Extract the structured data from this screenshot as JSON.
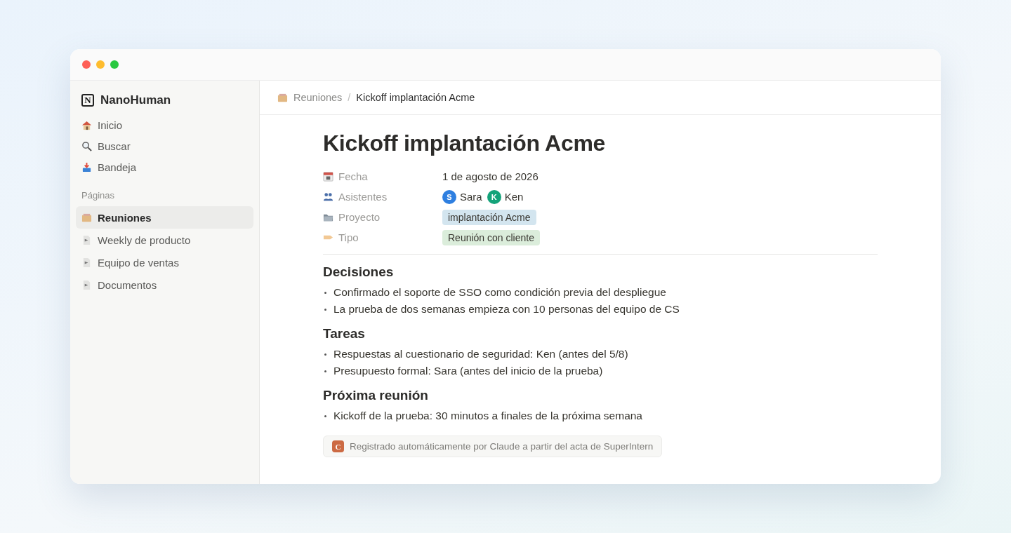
{
  "sidebar": {
    "workspace": {
      "logo_letter": "N",
      "name": "NanoHuman"
    },
    "nav": [
      {
        "label": "Inicio",
        "selected": false
      },
      {
        "label": "Buscar",
        "selected": false
      },
      {
        "label": "Bandeja",
        "selected": false
      }
    ],
    "section_title": "Páginas",
    "pages": [
      {
        "label": "Reuniones",
        "selected": true
      },
      {
        "label": "Weekly de producto",
        "selected": false
      },
      {
        "label": "Equipo de ventas",
        "selected": false
      },
      {
        "label": "Documentos",
        "selected": false
      }
    ]
  },
  "breadcrumb": {
    "parent": "Reuniones",
    "separator": "/",
    "current": "Kickoff implantación Acme"
  },
  "page": {
    "title": "Kickoff implantación Acme",
    "properties": [
      {
        "name": "Fecha",
        "kind": "text",
        "value": "1 de agosto de 2026"
      },
      {
        "name": "Asistentes",
        "kind": "people",
        "people": [
          {
            "initial": "S",
            "name": "Sara",
            "color": "#2e7fe0"
          },
          {
            "initial": "K",
            "name": "Ken",
            "color": "#14a37a"
          }
        ]
      },
      {
        "name": "Proyecto",
        "kind": "tag",
        "value": "implantación Acme",
        "color": "#d3e5ef"
      },
      {
        "name": "Tipo",
        "kind": "tag",
        "value": "Reunión con cliente",
        "color": "#dbeddb"
      }
    ],
    "sections": [
      {
        "heading": "Decisiones",
        "bullets": [
          "Confirmado el soporte de SSO como condición previa del despliegue",
          "La prueba de dos semanas empieza con 10 personas del equipo de CS"
        ]
      },
      {
        "heading": "Tareas",
        "bullets": [
          "Respuestas al cuestionario de seguridad: Ken (antes del 5/8)",
          "Presupuesto formal: Sara (antes del inicio de la prueba)"
        ]
      },
      {
        "heading": "Próxima reunión",
        "bullets": [
          "Kickoff de la prueba: 30 minutos a finales de la próxima semana"
        ]
      }
    ],
    "callout": {
      "badge": "C",
      "text": "Registrado automáticamente por Claude a partir del acta de SuperIntern"
    }
  }
}
